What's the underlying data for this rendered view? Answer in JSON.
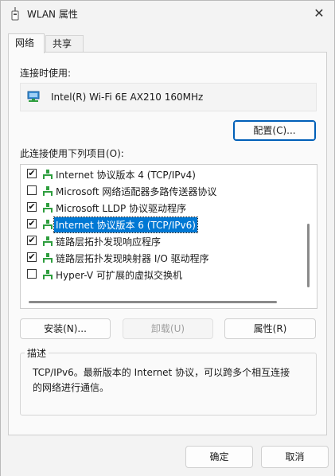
{
  "window": {
    "title": "WLAN 属性",
    "close_glyph": "✕"
  },
  "tabs": [
    {
      "label": "网络",
      "active": true
    },
    {
      "label": "共享",
      "active": false
    }
  ],
  "connection": {
    "label": "连接时使用:",
    "adapter_name": "Intel(R) Wi-Fi 6E AX210 160MHz",
    "adapter_icon": "network-adapter-icon",
    "configure_label": "配置(C)..."
  },
  "components": {
    "label": "此连接使用下列项目(O):",
    "items": [
      {
        "label": "Internet 协议版本 4 (TCP/IPv4)",
        "checked": true,
        "check_glyph": "✔",
        "selected": false
      },
      {
        "label": "Microsoft 网络适配器多路传送器协议",
        "checked": false,
        "check_glyph": "",
        "selected": false
      },
      {
        "label": "Microsoft LLDP 协议驱动程序",
        "checked": true,
        "check_glyph": "✔",
        "selected": false
      },
      {
        "label": "Internet 协议版本 6 (TCP/IPv6)",
        "checked": true,
        "check_glyph": "✔",
        "selected": true
      },
      {
        "label": "链路层拓扑发现响应程序",
        "checked": true,
        "check_glyph": "✔",
        "selected": false
      },
      {
        "label": "链路层拓扑发现映射器 I/O 驱动程序",
        "checked": true,
        "check_glyph": "✔",
        "selected": false
      },
      {
        "label": "Hyper-V 可扩展的虚拟交换机",
        "checked": false,
        "check_glyph": "",
        "selected": false
      }
    ]
  },
  "actions": {
    "install_label": "安装(N)...",
    "uninstall_label": "卸载(U)",
    "properties_label": "属性(R)"
  },
  "description": {
    "legend": "描述",
    "text": "TCP/IPv6。最新版本的 Internet 协议，可以跨多个相互连接的网络进行通信。"
  },
  "footer": {
    "ok_label": "确定",
    "cancel_label": "取消"
  },
  "colors": {
    "accent": "#0078d4",
    "selection_bg": "#0078d4",
    "network_icon": "#2e9e3e"
  }
}
